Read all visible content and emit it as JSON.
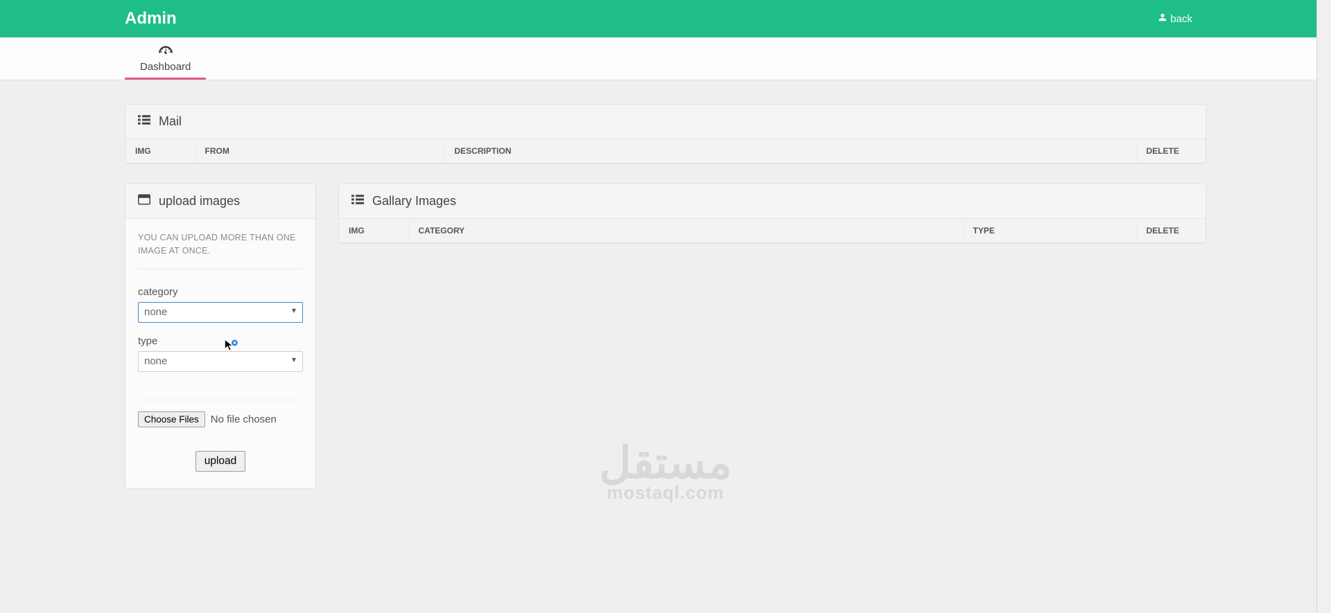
{
  "header": {
    "brand": "Admin",
    "back_label": "back"
  },
  "nav": {
    "dashboard_label": "Dashboard"
  },
  "mail_panel": {
    "title": "Mail",
    "columns": {
      "img": "IMG",
      "from": "FROM",
      "description": "DESCRIPTION",
      "delete": "DELETE"
    }
  },
  "upload_panel": {
    "title": "upload images",
    "help_text": "YOU CAN UPLOAD MORE THAN ONE IMAGE AT ONCE.",
    "category_label": "category",
    "category_value": "none",
    "type_label": "type",
    "type_value": "none",
    "choose_files_label": "Choose Files",
    "file_status": "No file chosen",
    "submit_label": "upload"
  },
  "gallery_panel": {
    "title": "Gallary Images",
    "columns": {
      "img": "IMG",
      "category": "CATEGORY",
      "type": "TYPE",
      "delete": "DELETE"
    }
  },
  "watermark": {
    "arabic": "مستقل",
    "latin": "mostaql.com"
  }
}
